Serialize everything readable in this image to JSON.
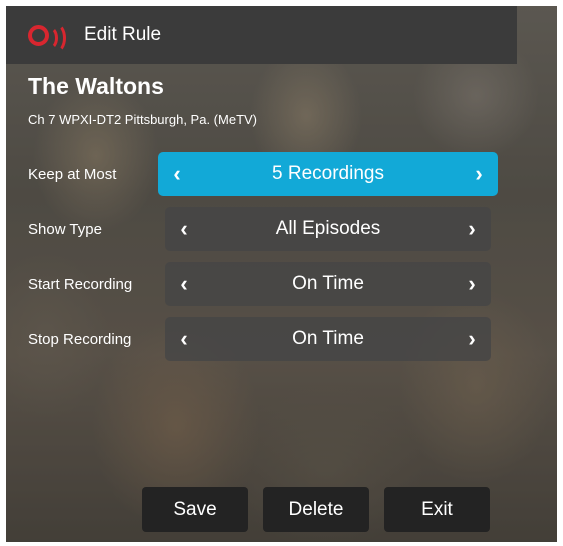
{
  "header": {
    "title": "Edit Rule",
    "logo": "broadcast-logo-icon",
    "logo_color": "#d8262f"
  },
  "show": {
    "title": "The Waltons",
    "channel": "Ch 7 WPXI-DT2 Pittsburgh, Pa. (MeTV)"
  },
  "settings": [
    {
      "label": "Keep at Most",
      "value": "5 Recordings",
      "active": true
    },
    {
      "label": "Show Type",
      "value": "All Episodes",
      "active": false
    },
    {
      "label": "Start Recording",
      "value": "On Time",
      "active": false
    },
    {
      "label": "Stop Recording",
      "value": "On Time",
      "active": false
    }
  ],
  "buttons": {
    "save": "Save",
    "delete": "Delete",
    "exit": "Exit"
  },
  "icons": {
    "prev": "‹",
    "next": "›"
  },
  "colors": {
    "accent": "#12a9d7",
    "panel": "#3b3b3b"
  }
}
